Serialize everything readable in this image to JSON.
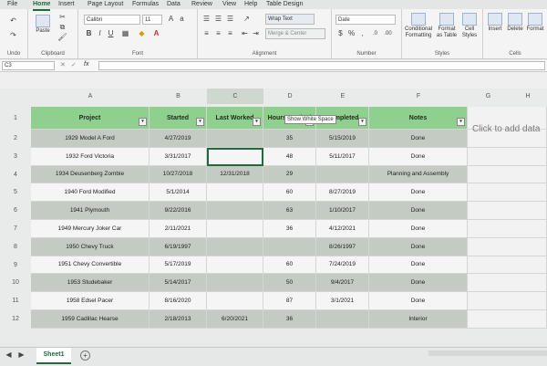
{
  "ribbon": {
    "tabs": [
      "File",
      "Insert",
      "Page Layout",
      "Formulas",
      "Data",
      "Review",
      "View",
      "Help",
      "Table Design"
    ],
    "active_tab": "Home",
    "groups": {
      "undo": "Undo",
      "clipboard": "Clipboard",
      "font": "Font",
      "alignment": "Alignment",
      "number": "Number",
      "styles": "Styles",
      "cells": "Cells"
    },
    "paste_label": "Paste",
    "font_name": "Calibri",
    "font_size": "11",
    "wrap_text": "Wrap Text",
    "merge_center": "Merge & Center",
    "number_format": "Date",
    "conditional_formatting": "Conditional Formatting",
    "format_as_table": "Format as Table",
    "cell_styles": "Cell Styles",
    "insert": "Insert",
    "delete": "Delete",
    "format": "Format"
  },
  "formula_bar": {
    "name_box": "C3",
    "fx": "fx"
  },
  "columns": [
    "A",
    "B",
    "C",
    "D",
    "E",
    "F",
    "G",
    "H"
  ],
  "table": {
    "headers": [
      "Project",
      "Started",
      "Last Worked",
      "Hours Worked",
      "Completed",
      "Notes"
    ],
    "rows": [
      [
        "1929 Model A Ford",
        "4/27/2019",
        "",
        "35",
        "5/15/2019",
        "Done"
      ],
      [
        "1932 Ford Victoria",
        "3/31/2017",
        "",
        "48",
        "5/11/2017",
        "Done"
      ],
      [
        "1934 Deusenberg Zombie",
        "10/27/2018",
        "12/31/2018",
        "29",
        "",
        "Planning and Assembly"
      ],
      [
        "1940 Ford Modified",
        "5/1/2014",
        "",
        "60",
        "8/27/2019",
        "Done"
      ],
      [
        "1941 Plymouth",
        "9/22/2016",
        "",
        "63",
        "1/10/2017",
        "Done"
      ],
      [
        "1949 Mercury Joker Car",
        "2/11/2021",
        "",
        "36",
        "4/12/2021",
        "Done"
      ],
      [
        "1950 Chevy Truck",
        "6/19/1997",
        "",
        "",
        "8/26/1997",
        "Done"
      ],
      [
        "1951 Chevy Convertible",
        "5/17/2019",
        "",
        "60",
        "7/24/2019",
        "Done"
      ],
      [
        "1953 Studebaker",
        "5/14/2017",
        "",
        "50",
        "9/4/2017",
        "Done"
      ],
      [
        "1958 Edsel Pacer",
        "8/16/2020",
        "",
        "87",
        "3/1/2021",
        "Done"
      ],
      [
        "1959 Cadillac Hearse",
        "2/18/2013",
        "6/20/2021",
        "36",
        "",
        "Interior"
      ]
    ]
  },
  "row_numbers": [
    "1",
    "2",
    "3",
    "4",
    "5",
    "6",
    "7",
    "8",
    "9",
    "10",
    "11",
    "12"
  ],
  "tooltip": "Show White Space",
  "placeholder": "Click to add data",
  "sheet_tab": "Sheet1",
  "add_sheet": "+"
}
